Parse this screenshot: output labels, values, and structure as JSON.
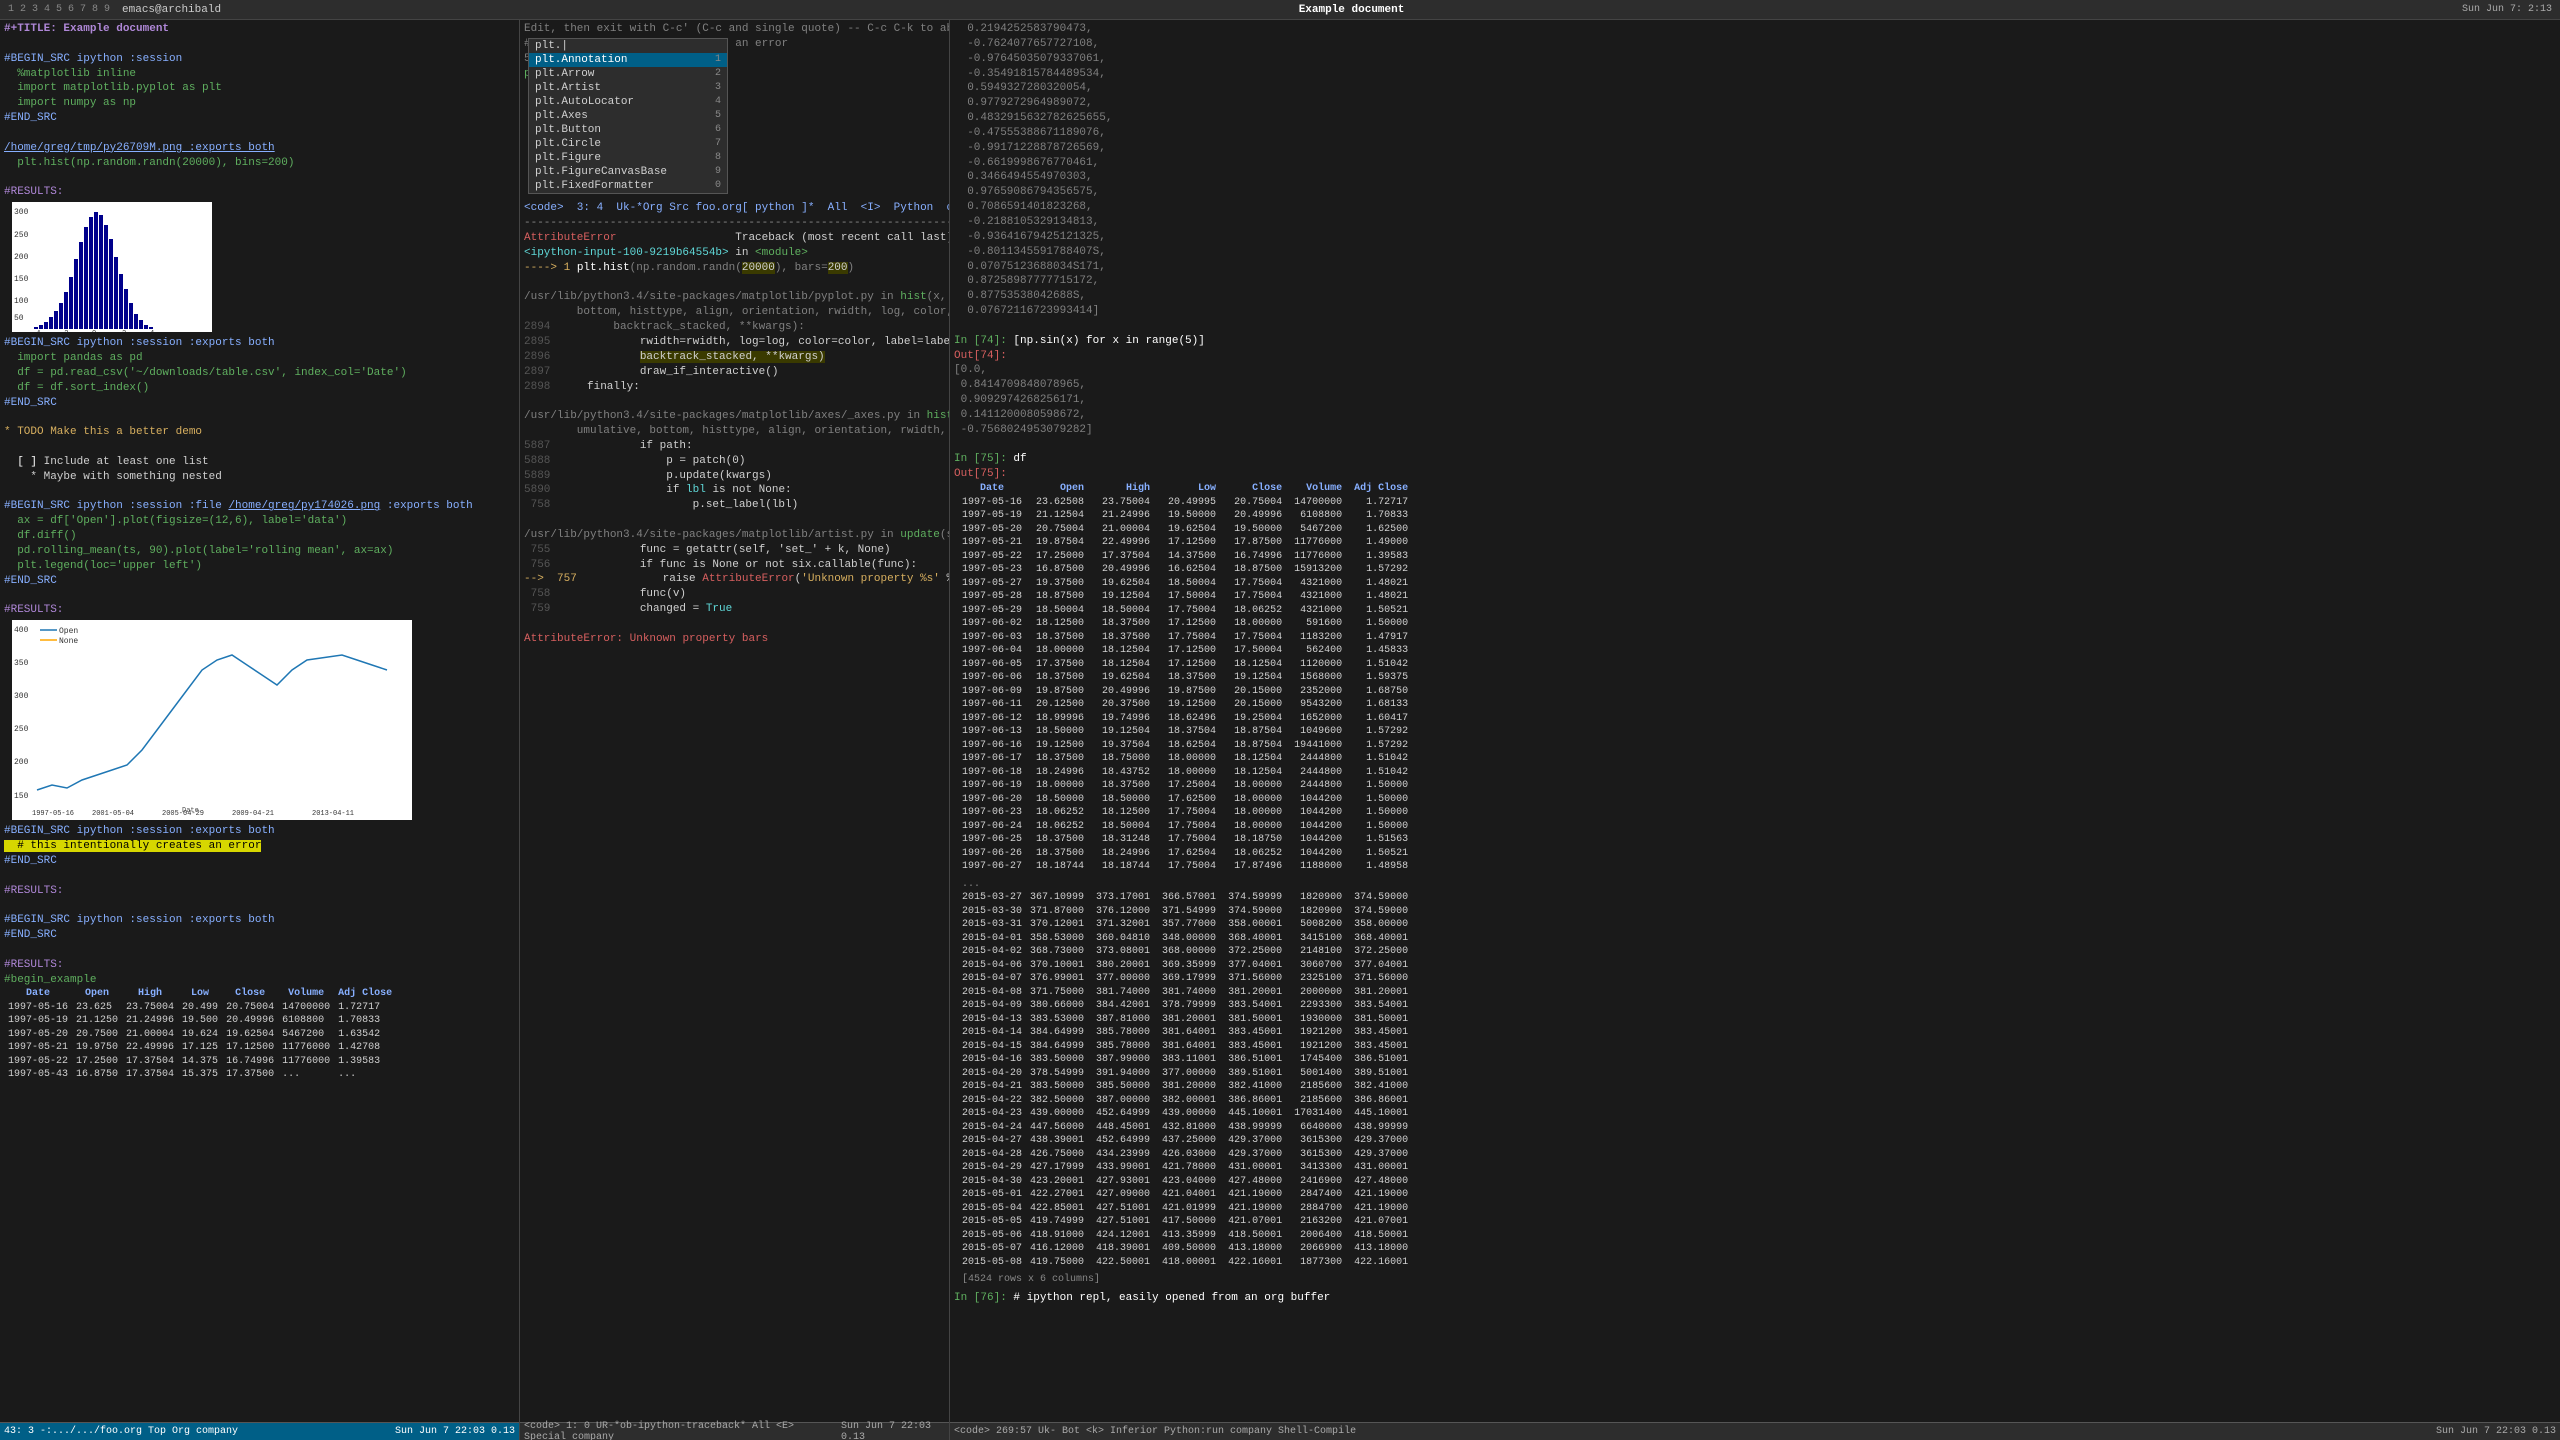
{
  "titleBar": {
    "tabs": [
      "1",
      "2",
      "3",
      "4",
      "5",
      "6",
      "7",
      "8",
      "9"
    ],
    "user": "emacs@archibald",
    "datetime": "Sun Jun  7:  2:13",
    "title": "Example document"
  },
  "leftPanel": {
    "statusBar": "#BEGIN_SRC ipython :session :exports both\nimport matplotlib.inline\nimport matplotlib.pyplot as plt\nimport numpy as np\n#END_SRC",
    "orgLink": "/home/greg/tmp/py26709M.png :exports both",
    "orgLink2": "/home/greg/py174026.png :exports both"
  },
  "middlePanel": {
    "header": "Edit, then exit with C-c' (C-c and single quote) -- C-c C-k to abort",
    "autocomplete": {
      "prefix": "plt.",
      "items": [
        {
          "label": "Annotation",
          "num": 1
        },
        {
          "label": "Arrow",
          "num": 2
        },
        {
          "label": "Artist",
          "num": 3
        },
        {
          "label": "AutoLocator",
          "num": 4
        },
        {
          "label": "Axes",
          "num": 5
        },
        {
          "label": "Button",
          "num": 6
        },
        {
          "label": "Circle",
          "num": 7
        },
        {
          "label": "Figure",
          "num": 8
        },
        {
          "label": "FigureCanvasBase",
          "num": 9
        },
        {
          "label": "FixedFormatter",
          "num": 0
        }
      ],
      "selected": 0
    }
  },
  "rightPanel": {
    "replPrompts": [
      {
        "num": "74",
        "type": "In",
        "code": "[np.sin(x) for x in range(5)]"
      },
      {
        "num": "74",
        "type": "Out",
        "values": "0.0,\n 0.8414709848078965,\n 0.9092974268256171,\n 0.1411200080598672,\n -0.7568024953079282]"
      },
      {
        "num": "75",
        "type": "In",
        "code": "df"
      },
      {
        "num": "75",
        "type": "Out"
      }
    ]
  },
  "errorText": "AttributeError: Unknown property bars",
  "tableHeaders": [
    "Date",
    "Open",
    "High",
    "Low",
    "Close",
    "Volume",
    "Adj Close"
  ],
  "bottomStatus": {
    "left": "43: 3 -:.../.../foo.org  Top  Org  company",
    "middle": "Sun Jun  7 22:03 0.13",
    "middle2": "<code>  1: 0 UR-*ob-ipython-traceback*  All  <E>  Special  company",
    "middle3": "Sun Jun  7 22:03 0.13",
    "right": "<code> 269:57  Uk-  Bot  <k>  Inferior Python:run  company  Shell-Compile",
    "rightTime": "Sun Jun  7 22:03 0.13"
  }
}
